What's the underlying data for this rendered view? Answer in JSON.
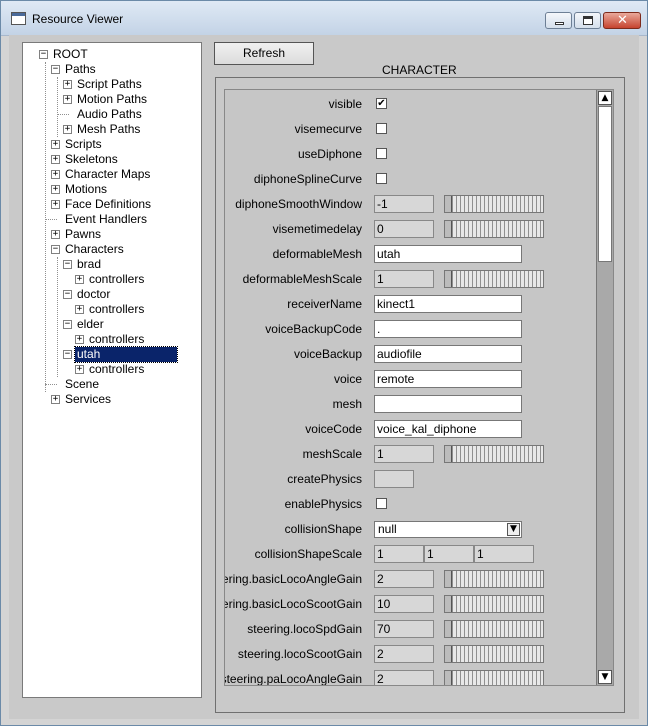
{
  "window": {
    "title": "Resource Viewer"
  },
  "toolbar": {
    "refresh_label": "Refresh"
  },
  "section": {
    "title": "CHARACTER"
  },
  "tree": {
    "root": "ROOT",
    "paths": "Paths",
    "script_paths": "Script Paths",
    "motion_paths": "Motion Paths",
    "audio_paths": "Audio Paths",
    "mesh_paths": "Mesh Paths",
    "scripts": "Scripts",
    "skeletons": "Skeletons",
    "character_maps": "Character Maps",
    "motions": "Motions",
    "face_definitions": "Face Definitions",
    "event_handlers": "Event Handlers",
    "pawns": "Pawns",
    "characters": "Characters",
    "brad": "brad",
    "brad_controllers": "controllers",
    "doctor": "doctor",
    "doctor_controllers": "controllers",
    "elder": "elder",
    "elder_controllers": "controllers",
    "utah": "utah",
    "utah_controllers": "controllers",
    "scene": "Scene",
    "services": "Services"
  },
  "props": {
    "visible": {
      "label": "visible",
      "checked": "✔"
    },
    "visemecurve": {
      "label": "visemecurve"
    },
    "useDiphone": {
      "label": "useDiphone"
    },
    "diphoneSplineCurve": {
      "label": "diphoneSplineCurve"
    },
    "diphoneSmoothWindow": {
      "label": "diphoneSmoothWindow",
      "value": "-1"
    },
    "visemetimedelay": {
      "label": "visemetimedelay",
      "value": "0"
    },
    "deformableMesh": {
      "label": "deformableMesh",
      "value": "utah"
    },
    "deformableMeshScale": {
      "label": "deformableMeshScale",
      "value": "1"
    },
    "receiverName": {
      "label": "receiverName",
      "value": "kinect1"
    },
    "voiceBackupCode": {
      "label": "voiceBackupCode",
      "value": "."
    },
    "voiceBackup": {
      "label": "voiceBackup",
      "value": "audiofile"
    },
    "voice": {
      "label": "voice",
      "value": "remote"
    },
    "mesh": {
      "label": "mesh",
      "value": ""
    },
    "voiceCode": {
      "label": "voiceCode",
      "value": "voice_kal_diphone"
    },
    "meshScale": {
      "label": "meshScale",
      "value": "1"
    },
    "createPhysics": {
      "label": "createPhysics"
    },
    "enablePhysics": {
      "label": "enablePhysics"
    },
    "collisionShape": {
      "label": "collisionShape",
      "value": "null"
    },
    "collisionShapeScale": {
      "label": "collisionShapeScale",
      "values": [
        "1",
        "1",
        "1"
      ]
    },
    "basicLocoAngleGain": {
      "label": "ering.basicLocoAngleGain",
      "value": "2"
    },
    "basicLocoScootGain": {
      "label": "ering.basicLocoScootGain",
      "value": "10"
    },
    "locoSpdGain": {
      "label": "steering.locoSpdGain",
      "value": "70"
    },
    "locoScootGain": {
      "label": "steering.locoScootGain",
      "value": "2"
    },
    "paLocoAngleGain": {
      "label": "steering.paLocoAngleGain",
      "value": "2"
    }
  }
}
